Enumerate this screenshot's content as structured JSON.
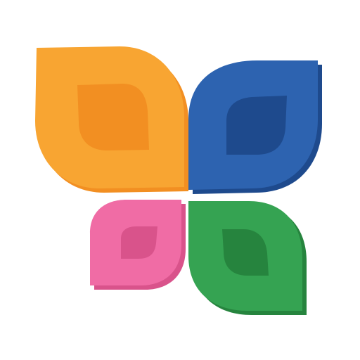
{
  "logo": {
    "kind": "four-petal flower app icon",
    "background": "#ffffff",
    "petals": [
      {
        "id": "orange",
        "position": "top-left",
        "fill": "#F8A532",
        "shade": "#F28F22",
        "hole": "#FFFFFF"
      },
      {
        "id": "blue",
        "position": "top-right",
        "fill": "#2D63B0",
        "shade": "#1E4A8D",
        "hole": "#FFFFFF"
      },
      {
        "id": "pink",
        "position": "bottom-left",
        "fill": "#F06CA5",
        "shade": "#D9538B",
        "hole": "#FFFFFF"
      },
      {
        "id": "green",
        "position": "bottom-right",
        "fill": "#35A352",
        "shade": "#26843E",
        "hole": "#FFFFFF"
      }
    ]
  }
}
